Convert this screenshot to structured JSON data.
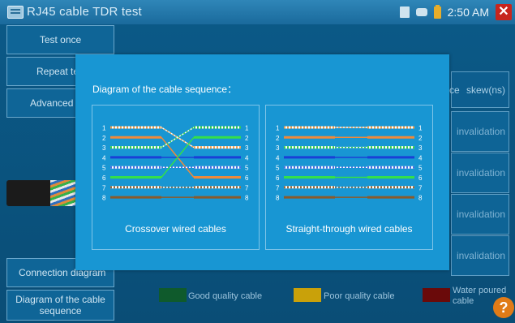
{
  "app": {
    "title": "RJ45 cable TDR test",
    "clock": "2:50 AM"
  },
  "left_buttons": {
    "test_once": "Test once",
    "repeat": "Repeat te",
    "advanced": "Advanced",
    "connection": "Connection diagram",
    "diagram": "Diagram of the cable sequence"
  },
  "table": {
    "header_prefix": "ce",
    "header": "skew(ns)",
    "rows": [
      "invalidation",
      "invalidation",
      "invalidation",
      "invalidation"
    ]
  },
  "legend": [
    {
      "label": "Good quality cable",
      "color": "#0f5a2c"
    },
    {
      "label": "Poor quality cable",
      "color": "#c9a10a"
    },
    {
      "label": "Water poured cable",
      "color": "#6a0a0a"
    }
  ],
  "modal": {
    "title": "Diagram of the cable sequence：",
    "panels": [
      {
        "caption": "Crossover wired cables",
        "pin_map": [
          3,
          6,
          1,
          4,
          5,
          2,
          7,
          8
        ]
      },
      {
        "caption": "Straight-through wired cables",
        "pin_map": [
          1,
          2,
          3,
          4,
          5,
          6,
          7,
          8
        ]
      }
    ],
    "wires": [
      {
        "pin": "1",
        "color": "#ffffff",
        "striped": true,
        "stripe": "#f0a050"
      },
      {
        "pin": "2",
        "color": "#f08a3a",
        "striped": false
      },
      {
        "pin": "3",
        "color": "#ffffff",
        "striped": true,
        "stripe": "#38d04a"
      },
      {
        "pin": "4",
        "color": "#1a3fd6",
        "striped": false
      },
      {
        "pin": "5",
        "color": "#ffffff",
        "striped": true,
        "stripe": "#4a6fe0"
      },
      {
        "pin": "6",
        "color": "#33e04a",
        "striped": false
      },
      {
        "pin": "7",
        "color": "#ffffff",
        "striped": true,
        "stripe": "#9a6a3a"
      },
      {
        "pin": "8",
        "color": "#8a5a2a",
        "striped": false
      }
    ]
  }
}
